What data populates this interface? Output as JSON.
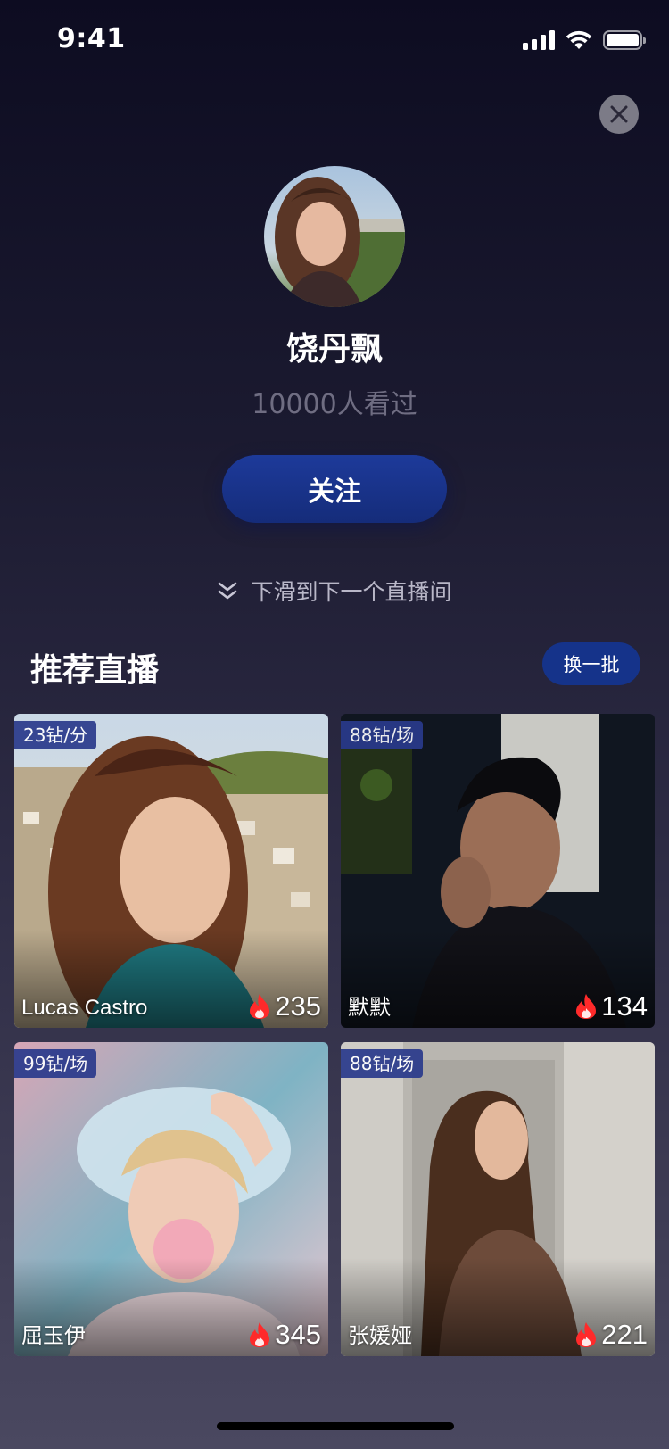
{
  "status_bar": {
    "time": "9:41"
  },
  "host": {
    "name": "饶丹飘",
    "viewers": "10000人看过",
    "follow_label": "关注",
    "swipe_hint": "下滑到下一个直播间"
  },
  "recommend": {
    "title": "推荐直播",
    "refresh_label": "换一批",
    "cards": [
      {
        "price": "23钻/分",
        "name": "Lucas Castro",
        "heat": "235"
      },
      {
        "price": "88钻/场",
        "name": "默默",
        "heat": "134"
      },
      {
        "price": "99钻/场",
        "name": "屈玉伊",
        "heat": "345"
      },
      {
        "price": "88钻/场",
        "name": "张媛娅",
        "heat": "221"
      }
    ]
  },
  "colors": {
    "accent_blue": "#15338a",
    "price_tag": "#2a3a8c",
    "heat_flame": "#ff2a2a",
    "secondary_text": "#6f6d82"
  }
}
